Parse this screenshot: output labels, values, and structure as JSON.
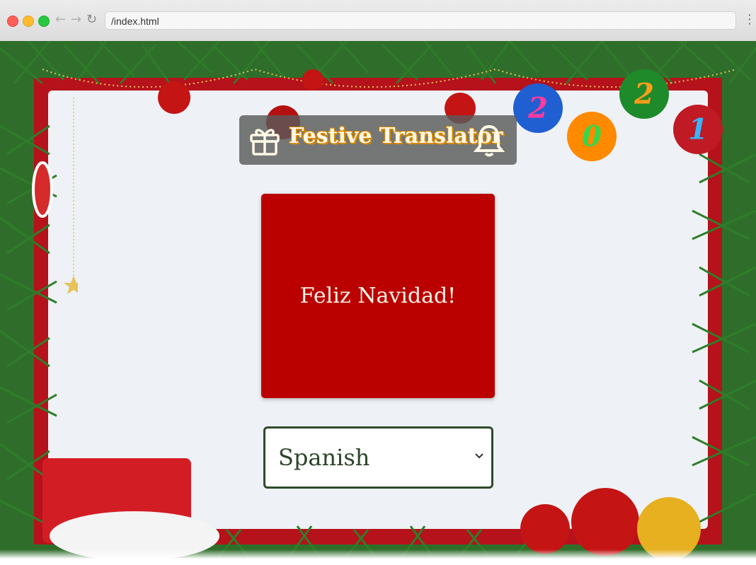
{
  "browser": {
    "url": "/index.html",
    "back_glyph": "←",
    "forward_glyph": "→",
    "reload_glyph": "↻",
    "menu_glyph": "⋮"
  },
  "header": {
    "title": "Festive Translator",
    "left_icon": "gift-icon",
    "right_icon": "bell-icon"
  },
  "translation": {
    "text": "Feliz Navidad!"
  },
  "language_select": {
    "selected": "Spanish"
  },
  "decoration": {
    "ornament_digits": [
      "2",
      "0",
      "2",
      "1"
    ]
  },
  "colors": {
    "card": "#bb0000",
    "frame": "#b5121b",
    "title_box": "#5a5a5a",
    "select_border": "#2e4a2a",
    "inner_bg": "#eef1f5"
  }
}
